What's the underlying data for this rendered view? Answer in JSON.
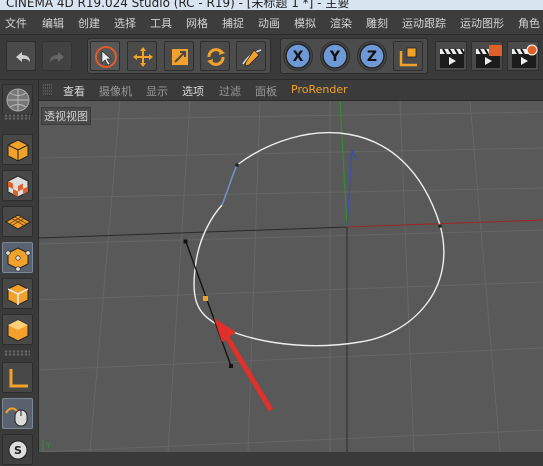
{
  "window": {
    "title": "CINEMA 4D R19.024 Studio (RC - R19) - [未标题 1 *] - 主要"
  },
  "menubar": {
    "items": [
      "文件",
      "编辑",
      "创建",
      "选择",
      "工具",
      "网格",
      "捕捉",
      "动画",
      "模拟",
      "渲染",
      "雕刻",
      "运动跟踪",
      "运动图形",
      "角色"
    ]
  },
  "toolbar": {
    "axis_x": "X",
    "axis_y": "Y",
    "axis_z": "Z"
  },
  "viewport_menu": {
    "items": [
      "查看",
      "摄像机",
      "显示",
      "选项",
      "过滤",
      "面板",
      "ProRender"
    ]
  },
  "viewport": {
    "label": "透视视图",
    "axis_label": "Y"
  },
  "colors": {
    "accent_orange": "#f2a22a",
    "axis_red": "#9b2626",
    "axis_green": "#2f8f2f",
    "spline_white": "#eeeeee",
    "spline_blue": "#6f8fc6",
    "arrow_red": "#e0302a",
    "viewport_bg": "#595959",
    "grid_line": "#656565",
    "axis_icon_blue": "#6f99d6"
  }
}
